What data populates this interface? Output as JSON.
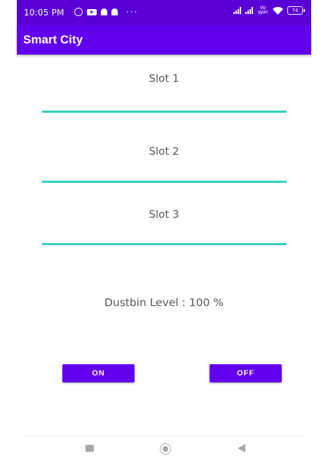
{
  "status_bar": {
    "time": "10:05 PM",
    "battery": "74",
    "volte": "Vo WiFi",
    "more_indicator": "···"
  },
  "app_bar": {
    "title": "Smart City"
  },
  "slots": [
    {
      "label": "Slot 1"
    },
    {
      "label": "Slot 2"
    },
    {
      "label": "Slot 3"
    }
  ],
  "dustbin": {
    "text": "Dustbin Level : 100 %"
  },
  "buttons": {
    "on_label": "ON",
    "off_label": "OFF"
  },
  "colors": {
    "accent": "#6200ee",
    "status_bar": "#5a00d6",
    "slot_line": "#2ccfc5",
    "text": "#555555"
  },
  "icons": {
    "status_left": [
      "alarm-icon",
      "youtube-icon",
      "snapchat-icon",
      "snapchat-icon"
    ],
    "status_right": [
      "signal-icon",
      "signal-icon",
      "volte-wifi-icon",
      "wifi-icon",
      "battery-icon"
    ],
    "nav": [
      "recents-icon",
      "home-icon",
      "back-icon"
    ]
  }
}
